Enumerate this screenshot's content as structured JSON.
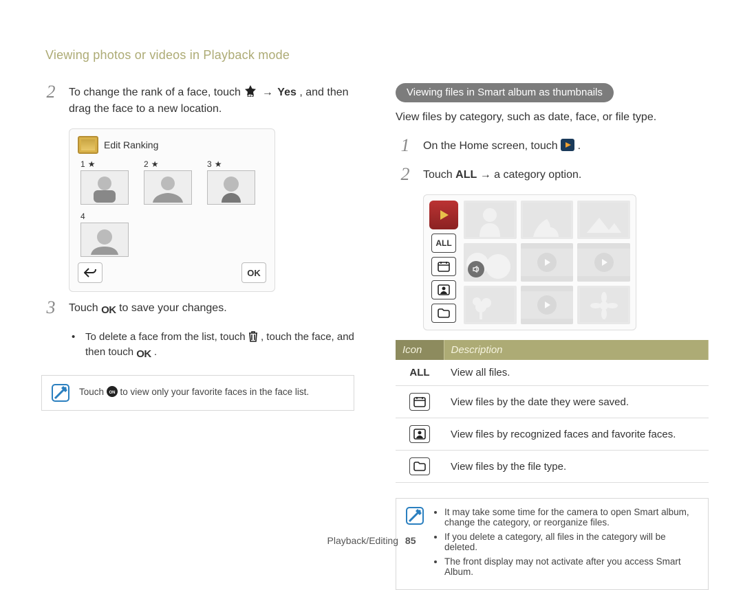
{
  "page_title": "Viewing photos or videos in Playback mode",
  "footer": {
    "section": "Playback/Editing",
    "page": "85"
  },
  "left": {
    "step2": {
      "num": "2",
      "t1": "To change the rank of a face, touch ",
      "t2": " → ",
      "t3": "Yes",
      "t4": ", and then drag the face to a new location."
    },
    "figure": {
      "title": "Edit Ranking",
      "ranks": [
        "1",
        "2",
        "3",
        "4"
      ],
      "ok": "OK"
    },
    "step3": {
      "num": "3",
      "t1": "Touch ",
      "ok": "OK",
      "t2": "  to save your changes."
    },
    "sub": {
      "t1": "To delete a face from the list, touch ",
      "t2": ", touch the face, and then touch ",
      "ok": "OK",
      "t3": "."
    },
    "note": {
      "t1": "Touch ",
      "t2": " to view only your favorite faces in the face list."
    }
  },
  "right": {
    "heading": "Viewing files in Smart album as thumbnails",
    "intro": "View files by category, such as date, face, or file type.",
    "step1": {
      "num": "1",
      "t1": "On the Home screen, touch ",
      "t2": "."
    },
    "step2": {
      "num": "2",
      "t1": "Touch ",
      "all": "ALL",
      "t2": " → a category option."
    },
    "album_side_all": "ALL",
    "table": {
      "headers": {
        "icon": "Icon",
        "desc": "Description"
      },
      "rows": [
        {
          "icon_type": "all",
          "label": "ALL",
          "desc": "View all files."
        },
        {
          "icon_type": "calendar",
          "desc": "View files by the date they were saved."
        },
        {
          "icon_type": "face",
          "desc": "View files by recognized faces and favorite faces."
        },
        {
          "icon_type": "folder",
          "desc": "View files by the file type."
        }
      ]
    },
    "note": {
      "items": [
        "It may take some time for the camera to open Smart album, change the category, or reorganize files.",
        "If you delete a category, all files in the category will be deleted.",
        "The front display may not activate after you access Smart Album."
      ]
    }
  }
}
